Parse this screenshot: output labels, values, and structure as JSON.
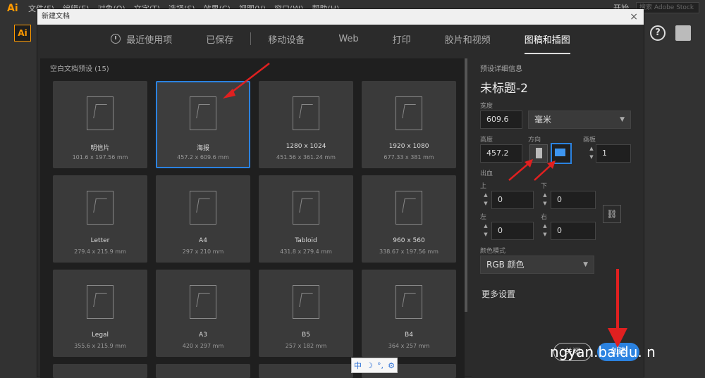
{
  "menubar": {
    "logo": "Ai",
    "items": [
      "文件(F)",
      "编辑(E)",
      "对象(O)",
      "文字(T)",
      "选择(S)",
      "效果(C)",
      "视图(V)",
      "窗口(W)",
      "帮助(H)"
    ],
    "workspace": "开始",
    "search_placeholder": "搜索 Adobe Stock"
  },
  "appbar": {
    "badge": "Ai",
    "help": "?"
  },
  "dialog": {
    "title": "新建文档",
    "close": "×",
    "tabs": [
      "最近使用项",
      "已保存",
      "移动设备",
      "Web",
      "打印",
      "胶片和视频",
      "图稿和插图"
    ],
    "active_tab": "图稿和插图"
  },
  "presets": {
    "label": "空白文档预设 (15)",
    "items": [
      {
        "name": "明信片",
        "dim": "101.6 x 197.56 mm"
      },
      {
        "name": "海报",
        "dim": "457.2 x 609.6 mm"
      },
      {
        "name": "1280 x 1024",
        "dim": "451.56 x 361.24 mm"
      },
      {
        "name": "1920 x 1080",
        "dim": "677.33 x 381 mm"
      },
      {
        "name": "Letter",
        "dim": "279.4 x 215.9 mm"
      },
      {
        "name": "A4",
        "dim": "297 x 210 mm"
      },
      {
        "name": "Tabloid",
        "dim": "431.8 x 279.4 mm"
      },
      {
        "name": "960 x 560",
        "dim": "338.67 x 197.56 mm"
      },
      {
        "name": "Legal",
        "dim": "355.6 x 215.9 mm"
      },
      {
        "name": "A3",
        "dim": "420 x 297 mm"
      },
      {
        "name": "B5",
        "dim": "257 x 182 mm"
      },
      {
        "name": "B4",
        "dim": "364 x 257 mm"
      }
    ],
    "selected": "海报"
  },
  "details": {
    "header": "预设详细信息",
    "doc_title": "未标题-2",
    "width_label": "宽度",
    "width_value": "609.6",
    "unit": "毫米",
    "height_label": "高度",
    "height_value": "457.2",
    "orientation_label": "方向",
    "artboards_label": "画板",
    "artboards_value": "1",
    "bleed_label": "出血",
    "top_label": "上",
    "top_value": "0",
    "bottom_label": "下",
    "bottom_value": "0",
    "left_label": "左",
    "left_value": "0",
    "right_label": "右",
    "right_value": "0",
    "color_mode_label": "颜色模式",
    "color_mode_value": "RGB 颜色",
    "more_settings": "更多设置",
    "close_button": "关闭",
    "create_button": "创建"
  },
  "ime": {
    "lang": "中",
    "moon": "☽",
    "punct": "°,",
    "gear": "⚙"
  },
  "watermark": "ngyan.baidu.   n",
  "colors": {
    "accent": "#2b82e0",
    "annotation": "#e02020",
    "brand": "#ff9a00"
  }
}
